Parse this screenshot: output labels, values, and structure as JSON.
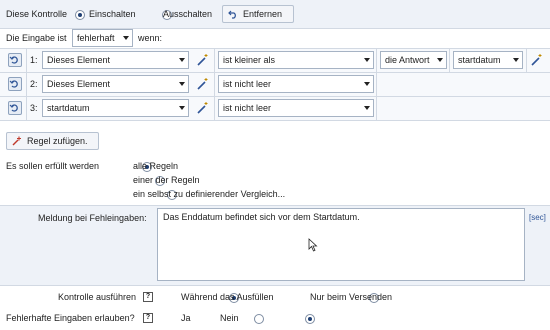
{
  "control": {
    "label": "Diese Kontrolle",
    "on_label": "Einschalten",
    "off_label": "Ausschalten",
    "remove_label": "Entfernen",
    "state": "on"
  },
  "condition": {
    "prefix": "Die Eingabe ist",
    "selected": "fehlerhaft",
    "suffix": "wenn:"
  },
  "rules": [
    {
      "index": "1:",
      "field": "Dieses Element",
      "operator": "ist kleiner als",
      "compare": "die Antwort",
      "target": "startdatum"
    },
    {
      "index": "2:",
      "field": "Dieses Element",
      "operator": "ist nicht leer"
    },
    {
      "index": "3:",
      "field": "startdatum",
      "operator": "ist nicht leer"
    }
  ],
  "add_rule_label": "Regel zufügen.",
  "fulfill": {
    "label": "Es sollen erfüllt werden",
    "options": [
      "alle Regeln",
      "einer der Regeln",
      "ein selbst zu definierender Vergleich..."
    ],
    "selected_index": 0
  },
  "message": {
    "label": "Meldung bei Fehleingaben:",
    "value": "Das Enddatum befindet sich vor dem Startdatum.",
    "side_link": "[sec]"
  },
  "run": {
    "label": "Kontrolle ausführen",
    "help": "?",
    "options": [
      "Während das Ausfüllen",
      "Nur beim Versenden"
    ],
    "selected_index": 0
  },
  "allow": {
    "label": "Fehlerhafte Eingaben erlauben?",
    "help": "?",
    "options": [
      "Ja",
      "Nein"
    ],
    "selected_index": 1
  },
  "colors": {
    "band": "#eef2f8",
    "border": "#a6b3c4",
    "accent": "#1f3f73"
  }
}
